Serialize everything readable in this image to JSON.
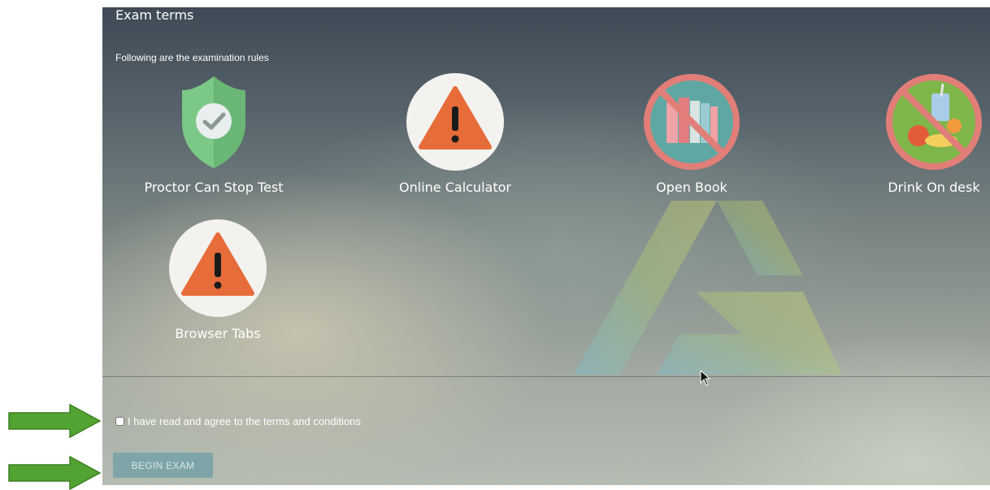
{
  "header": {
    "title": "Exam terms",
    "subtitle": "Following are the examination rules"
  },
  "rules": [
    {
      "label": "Proctor Can Stop Test",
      "icon": "shield-check-icon"
    },
    {
      "label": "Online Calculator",
      "icon": "warning-icon"
    },
    {
      "label": "Open Book",
      "icon": "no-books-icon"
    },
    {
      "label": "Drink On desk",
      "icon": "no-food-drink-icon"
    },
    {
      "label": "Browser Tabs",
      "icon": "warning-icon"
    }
  ],
  "agreement": {
    "label": "I have read and agree to the terms and conditions",
    "checked": false
  },
  "actions": {
    "begin_label": "BEGIN EXAM"
  },
  "colors": {
    "shield": "#7cc886",
    "warning": "#e66c3a",
    "prohibited_ring": "#e27e78",
    "button": "#7fa5a8",
    "annotation_arrow": "#4a9a2a"
  }
}
